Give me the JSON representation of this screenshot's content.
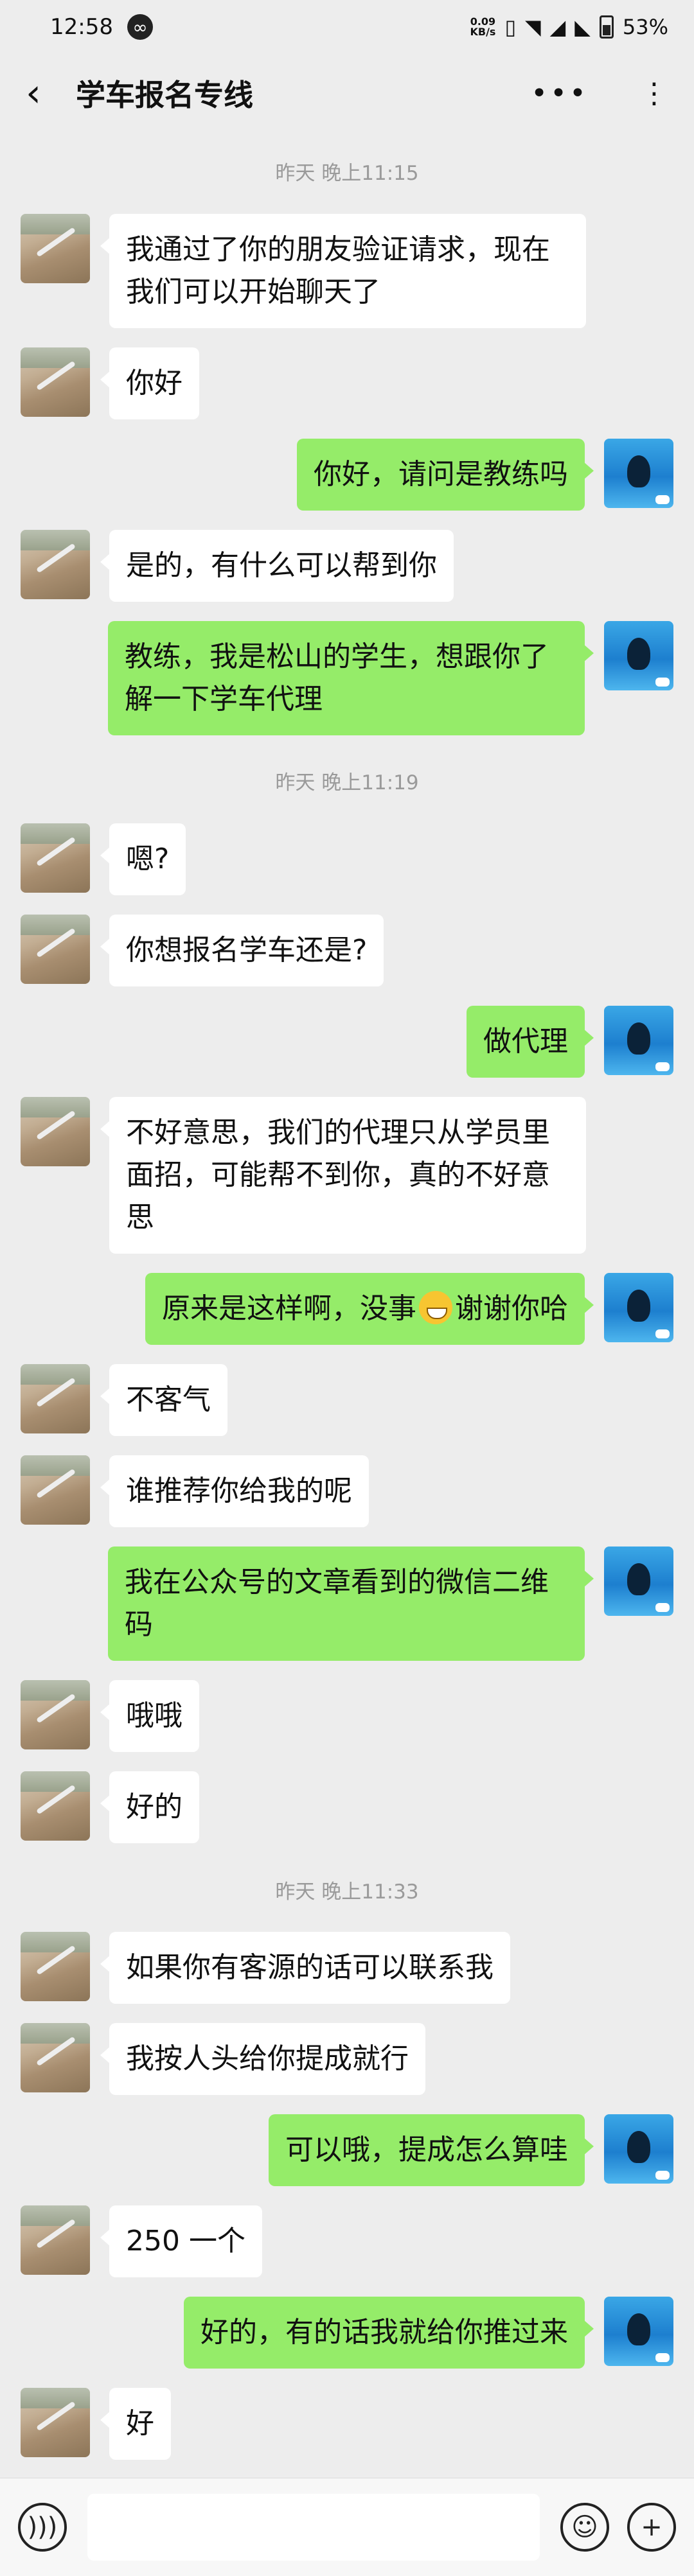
{
  "status_bar": {
    "time": "12:58",
    "network_speed": "0.09",
    "network_unit": "KB/s",
    "battery": "53%"
  },
  "header": {
    "title": "学车报名专线"
  },
  "timestamps": [
    "昨天 晚上11:15",
    "昨天 晚上11:19",
    "昨天 晚上11:33"
  ],
  "messages": [
    {
      "side": "left",
      "text": "我通过了你的朋友验证请求，现在我们可以开始聊天了"
    },
    {
      "side": "left",
      "text": "你好"
    },
    {
      "side": "right",
      "text": "你好，请问是教练吗"
    },
    {
      "side": "left",
      "text": "是的，有什么可以帮到你"
    },
    {
      "side": "right",
      "text": "教练，我是松山的学生，想跟你了解一下学车代理"
    },
    {
      "side": "left",
      "text": "嗯?"
    },
    {
      "side": "left",
      "text": "你想报名学车还是?"
    },
    {
      "side": "right",
      "text": "做代理"
    },
    {
      "side": "left",
      "text": "不好意思，我们的代理只从学员里面招，可能帮不到你，真的不好意思"
    },
    {
      "side": "right",
      "text_before": "原来是这样啊，没事",
      "emoji": "grinning-face",
      "text_after": "谢谢你哈"
    },
    {
      "side": "left",
      "text": "不客气"
    },
    {
      "side": "left",
      "text": "谁推荐你给我的呢"
    },
    {
      "side": "right",
      "text": "我在公众号的文章看到的微信二维码"
    },
    {
      "side": "left",
      "text": "哦哦"
    },
    {
      "side": "left",
      "text": "好的"
    },
    {
      "side": "left",
      "text": "如果你有客源的话可以联系我"
    },
    {
      "side": "left",
      "text": "我按人头给你提成就行"
    },
    {
      "side": "right",
      "text": "可以哦，提成怎么算哇"
    },
    {
      "side": "left",
      "text": "250 一个"
    },
    {
      "side": "right",
      "text": "好的，有的话我就给你推过来"
    },
    {
      "side": "left",
      "text": "好"
    }
  ],
  "input_bar": {
    "voice_icon": "voice-icon",
    "emoji_icon": "emoji-icon",
    "plus_icon": "plus-icon"
  }
}
